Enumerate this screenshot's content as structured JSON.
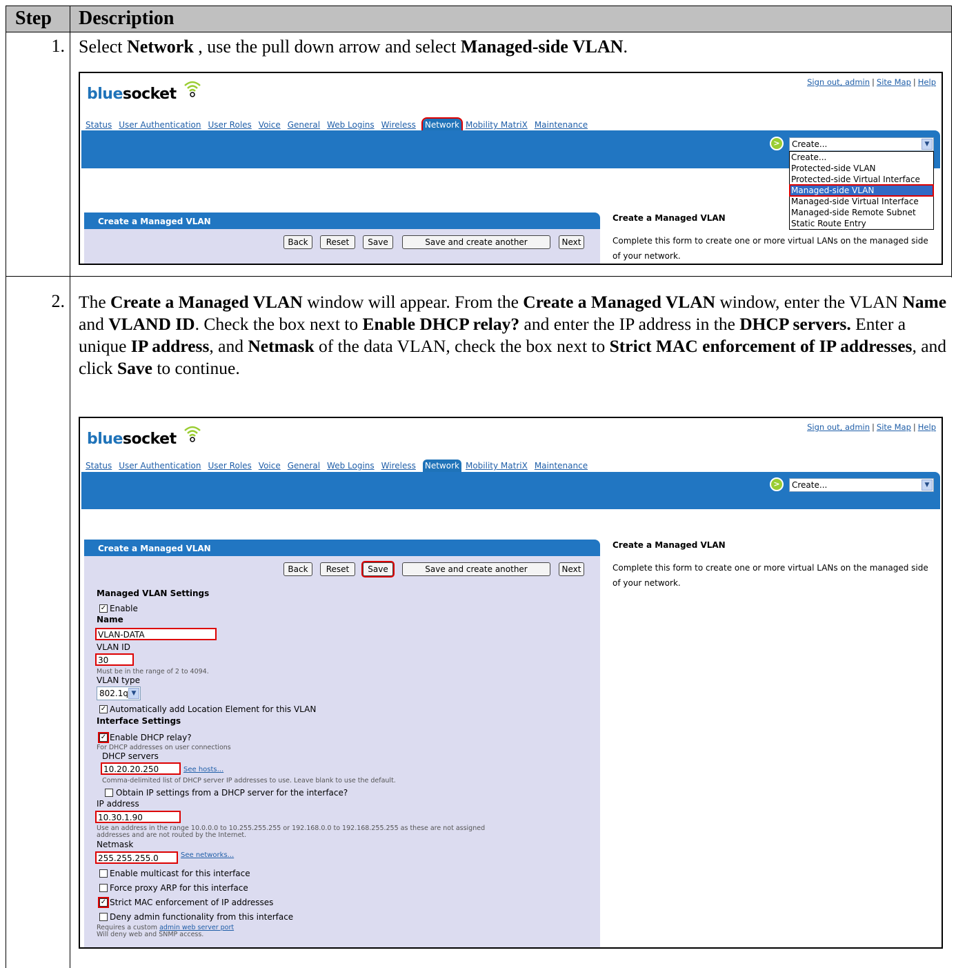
{
  "header": {
    "step": "Step",
    "description": "Description"
  },
  "steps": [
    {
      "num": "1.",
      "text_html": "Select <b>Network</b> , use the pull down arrow and  select <b>Managed-side VLAN</b>."
    },
    {
      "num": "2.",
      "text_html": "The <b>Create a Managed VLAN</b> window will appear. From the <b>Create a Managed VLAN</b> window, enter the VLAN <b>Name</b> and <b>VLAND ID</b>. Check the box next to <b>Enable DHCP relay?</b> and enter the IP address in the <b>DHCP servers.</b> Enter a unique <b>IP address</b>, and <b>Netmask</b> of the data VLAN, check the box next to <b>Strict MAC enforcement of IP addresses</b>, and click <b>Save</b> to continue."
    }
  ],
  "app": {
    "logo_blue": "blue",
    "logo_black": "socket",
    "sign_out": "Sign out, admin",
    "site_map": "Site Map",
    "help": "Help",
    "sep": "|",
    "nav": [
      "Status",
      "User Authentication",
      "User Roles",
      "Voice",
      "General",
      "Web Logins",
      "Wireless",
      "Network",
      "Mobility MatriX",
      "Maintenance"
    ],
    "go_icon": ">",
    "select_value": "Create...",
    "select_arrow": "▼",
    "dropdown": [
      "Create...",
      "Protected-side VLAN",
      "Protected-side Virtual Interface",
      "Managed-side VLAN",
      "Managed-side Virtual Interface",
      "Managed-side Remote Subnet",
      "Static Route Entry"
    ],
    "panel_title": "Create a Managed VLAN",
    "buttons": {
      "back": "Back",
      "reset": "Reset",
      "save": "Save",
      "save_another": "Save and create another",
      "next": "Next"
    },
    "right_title": "Create a Managed VLAN",
    "right_text": "Complete this form to create one or more virtual LANs on the managed side of your network."
  },
  "form": {
    "section1": "Managed VLAN Settings",
    "enable": "Enable",
    "name_label": "Name",
    "name_value": "VLAN-DATA",
    "vlanid_label": "VLAN ID",
    "vlanid_value": "30",
    "vlanid_hint": "Must be in the range of 2 to 4094.",
    "vlantype_label": "VLAN type",
    "vlantype_value": "802.1q",
    "auto_location": "Automatically add Location Element for this VLAN",
    "section2": "Interface Settings",
    "dhcp_relay": "Enable DHCP relay?",
    "dhcp_relay_hint": "For DHCP addresses on user connections",
    "dhcp_servers_label": "DHCP servers",
    "dhcp_servers_value": "10.20.20.250",
    "see_hosts": "See hosts...",
    "dhcp_servers_hint": "Comma-delimited list of DHCP server IP addresses to use. Leave blank to use the default.",
    "obtain_ip": "Obtain IP settings from a DHCP server for the interface?",
    "ip_label": "IP address",
    "ip_value": "10.30.1.90",
    "ip_hint1": "Use an address in the range 10.0.0.0 to 10.255.255.255 or 192.168.0.0 to 192.168.255.255 as these are not assigned",
    "ip_hint2": "addresses and are not routed by the Internet.",
    "netmask_label": "Netmask",
    "netmask_value": "255.255.255.0",
    "see_networks": "See networks...",
    "multicast": "Enable multicast for this interface",
    "proxy_arp": "Force proxy ARP for this interface",
    "strict_mac": "Strict MAC enforcement of IP addresses",
    "deny_admin": "Deny admin functionality from this interface",
    "deny_hint1_pre": "Requires a custom ",
    "deny_hint1_link": "admin web server port",
    "deny_hint2": "Will deny web and SNMP access.",
    "check": "✓"
  },
  "colors": {
    "accent": "#2176c2",
    "highlight": "#d00000",
    "panel": "#dcdcf0"
  }
}
